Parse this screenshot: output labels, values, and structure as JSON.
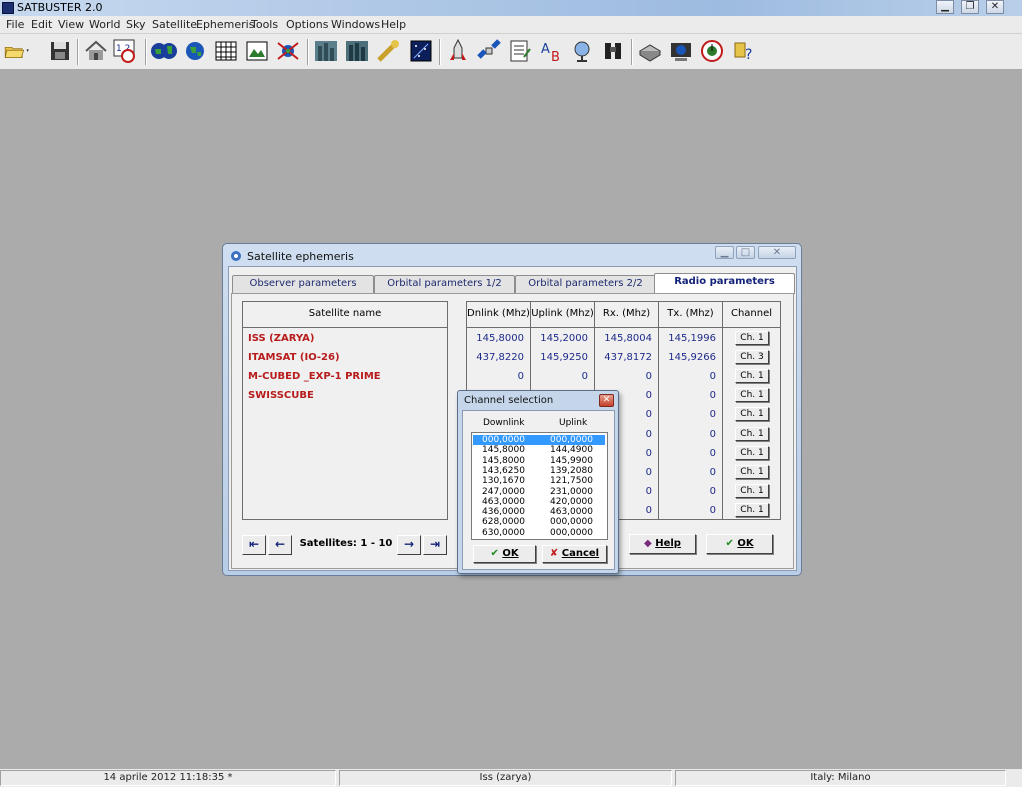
{
  "app": {
    "title": "SATBUSTER 2.0"
  },
  "menu": [
    "File",
    "Edit",
    "View",
    "World",
    "Sky",
    "Satellite",
    "Ephemeris",
    "Tools",
    "Options",
    "Windows",
    "Help"
  ],
  "toolbar_icons": [
    "open-folder-icon",
    "save-icon",
    "home-icon",
    "calendar-clock-icon",
    "world-map-icon",
    "globe-icon",
    "grid-icon",
    "map-chart-icon",
    "satellite-network-icon",
    "city-icon",
    "city-night-icon",
    "comet-icon",
    "star-field-icon",
    "rocket-icon",
    "satellite-icon",
    "notepad-icon",
    "font-ab-icon",
    "globe-stand-icon",
    "binoculars-icon",
    "printer-icon",
    "monitor-globe-icon",
    "clock-globe-icon",
    "help-pointer-icon"
  ],
  "dialog": {
    "title": "Satellite ephemeris",
    "tabs": [
      "Observer parameters",
      "Orbital parameters 1/2",
      "Orbital parameters 2/2",
      "Radio parameters"
    ],
    "active_tab": "Radio parameters",
    "satellite_header": "Satellite name",
    "satellites": [
      "ISS (ZARYA)",
      "ITAMSAT (IO-26)",
      "M-CUBED _EXP-1 PRIME",
      "SWISSCUBE"
    ],
    "columns": [
      "Dnlink (Mhz)",
      "Uplink (Mhz)",
      "Rx. (Mhz)",
      "Tx. (Mhz)",
      "Channel"
    ],
    "rows": [
      {
        "dn": "145,8000",
        "up": "145,2000",
        "rx": "145,8004",
        "tx": "145,1996",
        "ch": "Ch. 1"
      },
      {
        "dn": "437,8220",
        "up": "145,9250",
        "rx": "437,8172",
        "tx": "145,9266",
        "ch": "Ch. 3"
      },
      {
        "dn": "0",
        "up": "0",
        "rx": "0",
        "tx": "0",
        "ch": "Ch. 1"
      },
      {
        "dn": "",
        "up": "",
        "rx": "0",
        "tx": "0",
        "ch": "Ch. 1"
      },
      {
        "dn": "",
        "up": "",
        "rx": "0",
        "tx": "0",
        "ch": "Ch. 1"
      },
      {
        "dn": "",
        "up": "",
        "rx": "0",
        "tx": "0",
        "ch": "Ch. 1"
      },
      {
        "dn": "",
        "up": "",
        "rx": "0",
        "tx": "0",
        "ch": "Ch. 1"
      },
      {
        "dn": "",
        "up": "",
        "rx": "0",
        "tx": "0",
        "ch": "Ch. 1"
      },
      {
        "dn": "",
        "up": "",
        "rx": "0",
        "tx": "0",
        "ch": "Ch. 1"
      },
      {
        "dn": "",
        "up": "",
        "rx": "0",
        "tx": "0",
        "ch": "Ch. 1"
      }
    ],
    "nav": {
      "first": "⇤",
      "prev": "←",
      "label": "Satellites:  1 - 10",
      "next": "→",
      "last": "⇥"
    },
    "help_button": "Help",
    "ok_button": "OK"
  },
  "channel_popup": {
    "title": "Channel selection",
    "headers": [
      "Downlink",
      "Uplink"
    ],
    "selected_index": 0,
    "channels": [
      [
        "000,0000",
        "000,0000"
      ],
      [
        "145,8000",
        "144,4900"
      ],
      [
        "145,8000",
        "145,9900"
      ],
      [
        "143,6250",
        "139,2080"
      ],
      [
        "130,1670",
        "121,7500"
      ],
      [
        "247,0000",
        "231,0000"
      ],
      [
        "463,0000",
        "420,0000"
      ],
      [
        "436,0000",
        "463,0000"
      ],
      [
        "628,0000",
        "000,0000"
      ],
      [
        "630,0000",
        "000,0000"
      ]
    ],
    "ok_button": "OK",
    "cancel_button": "Cancel"
  },
  "status": {
    "datetime": "14 aprile 2012  11:18:35 *",
    "satellite": "Iss (zarya)",
    "location": "Italy: Milano"
  }
}
